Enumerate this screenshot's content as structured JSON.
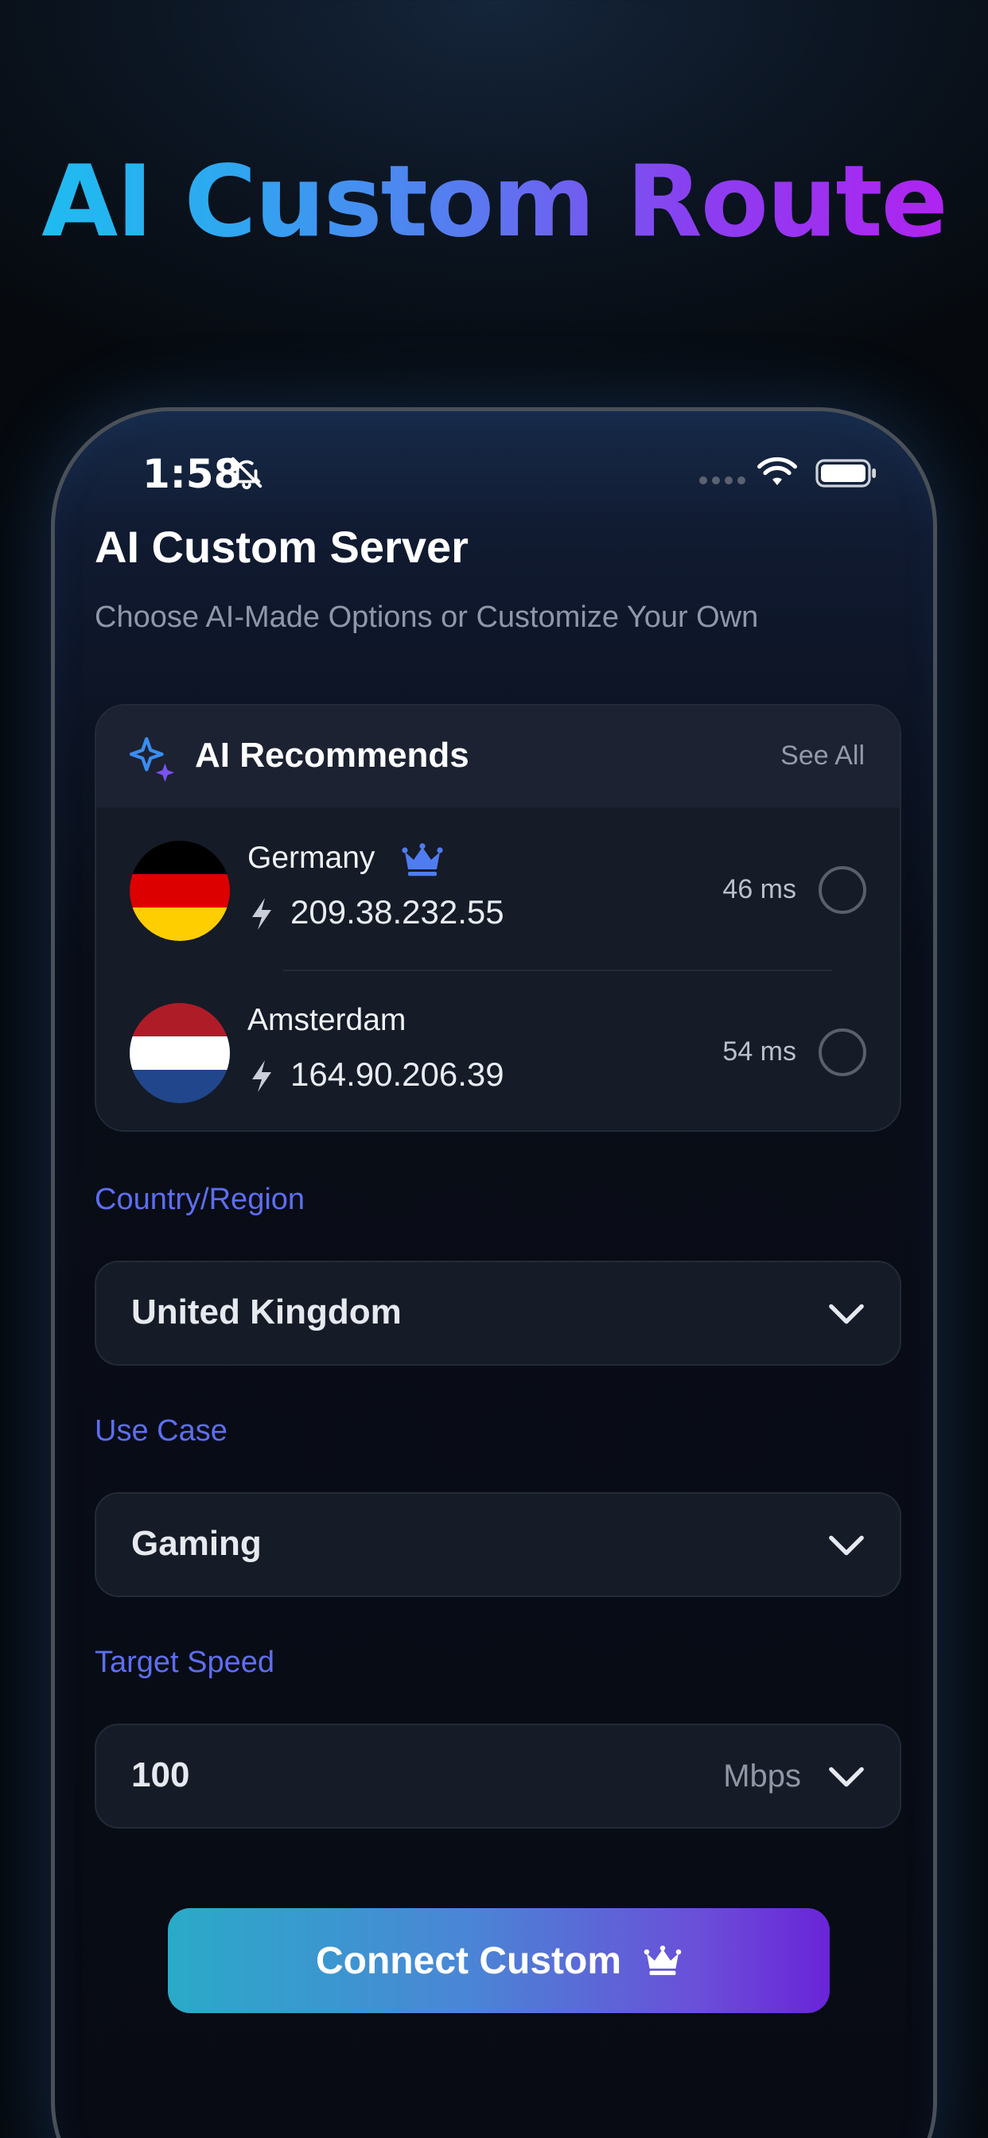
{
  "headline": "AI Custom Route",
  "status_bar": {
    "time": "1:58",
    "icons": [
      "bell-slash-icon",
      "signal-dots-icon",
      "wifi-icon",
      "battery-icon"
    ]
  },
  "screen": {
    "title": "AI Custom Server",
    "subtitle": "Choose AI-Made Options or Customize Your Own"
  },
  "recommendations": {
    "title": "AI Recommends",
    "see_all": "See All",
    "servers": [
      {
        "name": "Germany",
        "premium": true,
        "ip": "209.38.232.55",
        "ping": "46 ms",
        "flag_colors": [
          "#000000",
          "#dd0000",
          "#ffce00"
        ],
        "selected": false
      },
      {
        "name": "Amsterdam",
        "premium": false,
        "ip": "164.90.206.39",
        "ping": "54 ms",
        "flag_colors": [
          "#ae1c28",
          "#ffffff",
          "#21468b"
        ],
        "selected": false
      }
    ]
  },
  "form": {
    "country": {
      "label": "Country/Region",
      "value": "United Kingdom"
    },
    "use_case": {
      "label": "Use Case",
      "value": "Gaming"
    },
    "speed": {
      "label": "Target Speed",
      "value": "100",
      "unit": "Mbps"
    }
  },
  "connect_button": {
    "label": "Connect Custom",
    "icon": "crown-icon"
  },
  "colors": {
    "accent_blue": "#5d6ef0",
    "gradient_start": "#1fbcf0",
    "gradient_end": "#b023f0",
    "crown_blue": "#4f7cf0"
  }
}
